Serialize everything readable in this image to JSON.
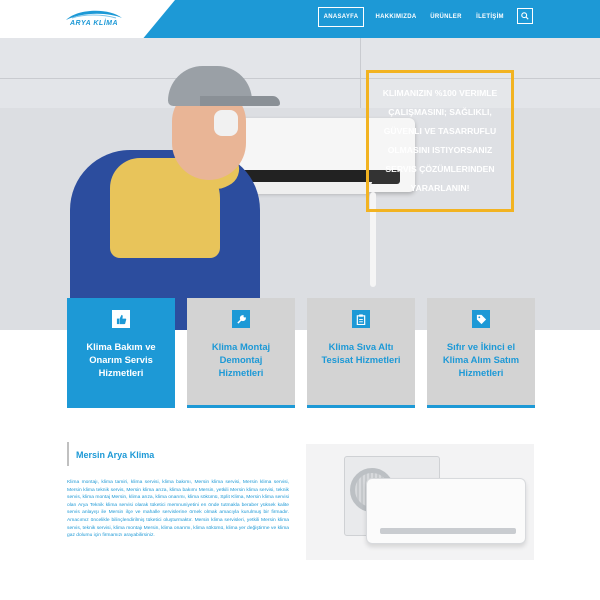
{
  "brand": {
    "logo_text": "ARYA KLİMA",
    "primary": "#1d99d6",
    "accent": "#f2b321"
  },
  "nav": {
    "items": [
      "ANASAYFA",
      "HAKKIMIZDA",
      "ÜRÜNLER",
      "İLETİŞİM"
    ],
    "active": "ANASAYFA",
    "search_icon": "search-icon"
  },
  "hero": {
    "promo_lines": [
      "KLIMANIZIN %100 VERIMLE",
      "ÇALIŞMASINI; SAĞLIKLI,",
      "GÜVENLI VE TASARRUFLU",
      "OLMASINI ISTIYORSANIZ",
      "SERVIS ÇÖZÜMLERINDEN",
      "YARARLANIN!"
    ]
  },
  "services": [
    {
      "title_lines": [
        "Klima Bakım ve",
        "Onarım Servis",
        "Hizmetleri"
      ],
      "icon": "thumbs-up-icon",
      "highlighted": true
    },
    {
      "title_lines": [
        "Klima Montaj",
        "Demontaj",
        "Hizmetleri"
      ],
      "icon": "wrench-icon",
      "highlighted": false
    },
    {
      "title_lines": [
        "Klima Sıva Altı",
        "Tesisat Hizmetleri"
      ],
      "icon": "clipboard-icon",
      "highlighted": false
    },
    {
      "title_lines": [
        "Sıfır ve İkinci el",
        "Klima Alım Satım",
        "Hizmetleri"
      ],
      "icon": "tag-icon",
      "highlighted": false
    }
  ],
  "about": {
    "title": "Mersin Arya Klima",
    "body": "Klima montajı, klima tamiri, klima servisi, klima bakımı, Mersin klima servisi, Mersin klima servisi, Mersin klima teknik servis, Mersin klima arıza, klima bakımı Mersin, yetkili Mersin klima servisi, teknik servis, klima montaj Mersin, klima arıza, klima onarımı, klima sökümü, Split Klima, Mersin klima servisi olan Arya Teknik klima servisi olarak tüketici memnuniyetini en önde tutmakla beraber yüksek kalite servis anlayışı ile Mersin ilçe ve mahalle servislerine örnek olmak amacıyla kurulmuş bir firmadır. Amacımız öncelikle bilinçlendirilmiş tüketici oluşturmaktır. Mersin klima servisleri, yetkili Mersin klima servis, teknik servisi, klima montajı Mersin, klima onarımı, klima sökümü, klima yer değiştirme ve klima gaz dolumu için firmamızı arayabilirsiniz."
  }
}
